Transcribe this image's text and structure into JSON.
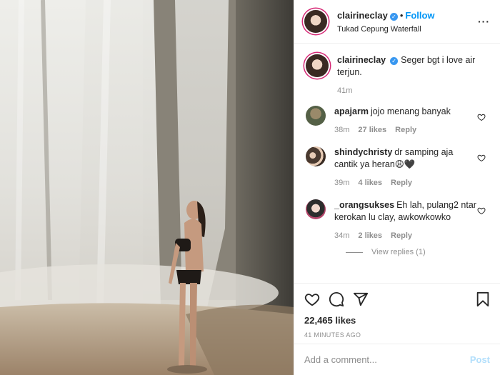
{
  "header": {
    "username": "clairineclay",
    "follow_label": "Follow",
    "dot": "•",
    "location": "Tukad Cepung Waterfall",
    "more": "···",
    "verified_mark": "✓"
  },
  "caption": {
    "username": "clairineclay",
    "text": "Seger bgt i love air terjun.",
    "time": "41m"
  },
  "comments": [
    {
      "username": "apajarm",
      "text": "jojo menang banyak",
      "time": "38m",
      "likes": "27 likes",
      "reply": "Reply"
    },
    {
      "username": "shindychristy",
      "text": "dr samping aja cantik ya heran😩🖤",
      "time": "39m",
      "likes": "4 likes",
      "reply": "Reply"
    },
    {
      "username": "_orangsukses",
      "text": "Eh lah, pulang2 ntar kerokan lu clay, awkowkowko",
      "time": "34m",
      "likes": "2 likes",
      "reply": "Reply",
      "view_replies": "View replies (1)"
    }
  ],
  "actions": {
    "like_icon": "heart-icon",
    "comment_icon": "comment-icon",
    "share_icon": "share-icon",
    "save_icon": "bookmark-icon",
    "likes_count": "22,465 likes",
    "time_ago": "41 MINUTES AGO"
  },
  "add_comment": {
    "placeholder": "Add a comment...",
    "post_label": "Post"
  },
  "colors": {
    "link_blue": "#0095f6",
    "verified_blue": "#3897f0",
    "muted": "#8e8e8e",
    "post_disabled": "#b2dffc"
  }
}
